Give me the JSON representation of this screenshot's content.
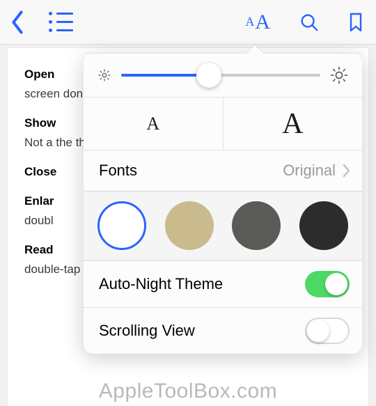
{
  "toolbar": {
    "font_size_symbol_small": "A",
    "font_size_symbol_big": "A"
  },
  "page": {
    "paragraphs": [
      {
        "bold": "Open",
        "rest": " screen don't see o"
      },
      {
        "bold": "Show",
        "rest": " Not a the th the ta"
      },
      {
        "bold": "Close",
        "rest": ""
      },
      {
        "bold": "Enlar",
        "rest": " doubl"
      },
      {
        "bold": "Read",
        "rest": " double-tap a column of text to zoom in, then swipe"
      }
    ]
  },
  "popover": {
    "brightness": {
      "value_percent": 44
    },
    "fontsize": {
      "small": "A",
      "big": "A"
    },
    "fonts": {
      "label": "Fonts",
      "value": "Original"
    },
    "themes": [
      "white",
      "sepia",
      "gray",
      "black"
    ],
    "selected_theme": "white",
    "auto_night": {
      "label": "Auto-Night Theme",
      "on": true
    },
    "scrolling_view": {
      "label": "Scrolling View",
      "on": false
    }
  },
  "watermark": "AppleToolBox.com"
}
